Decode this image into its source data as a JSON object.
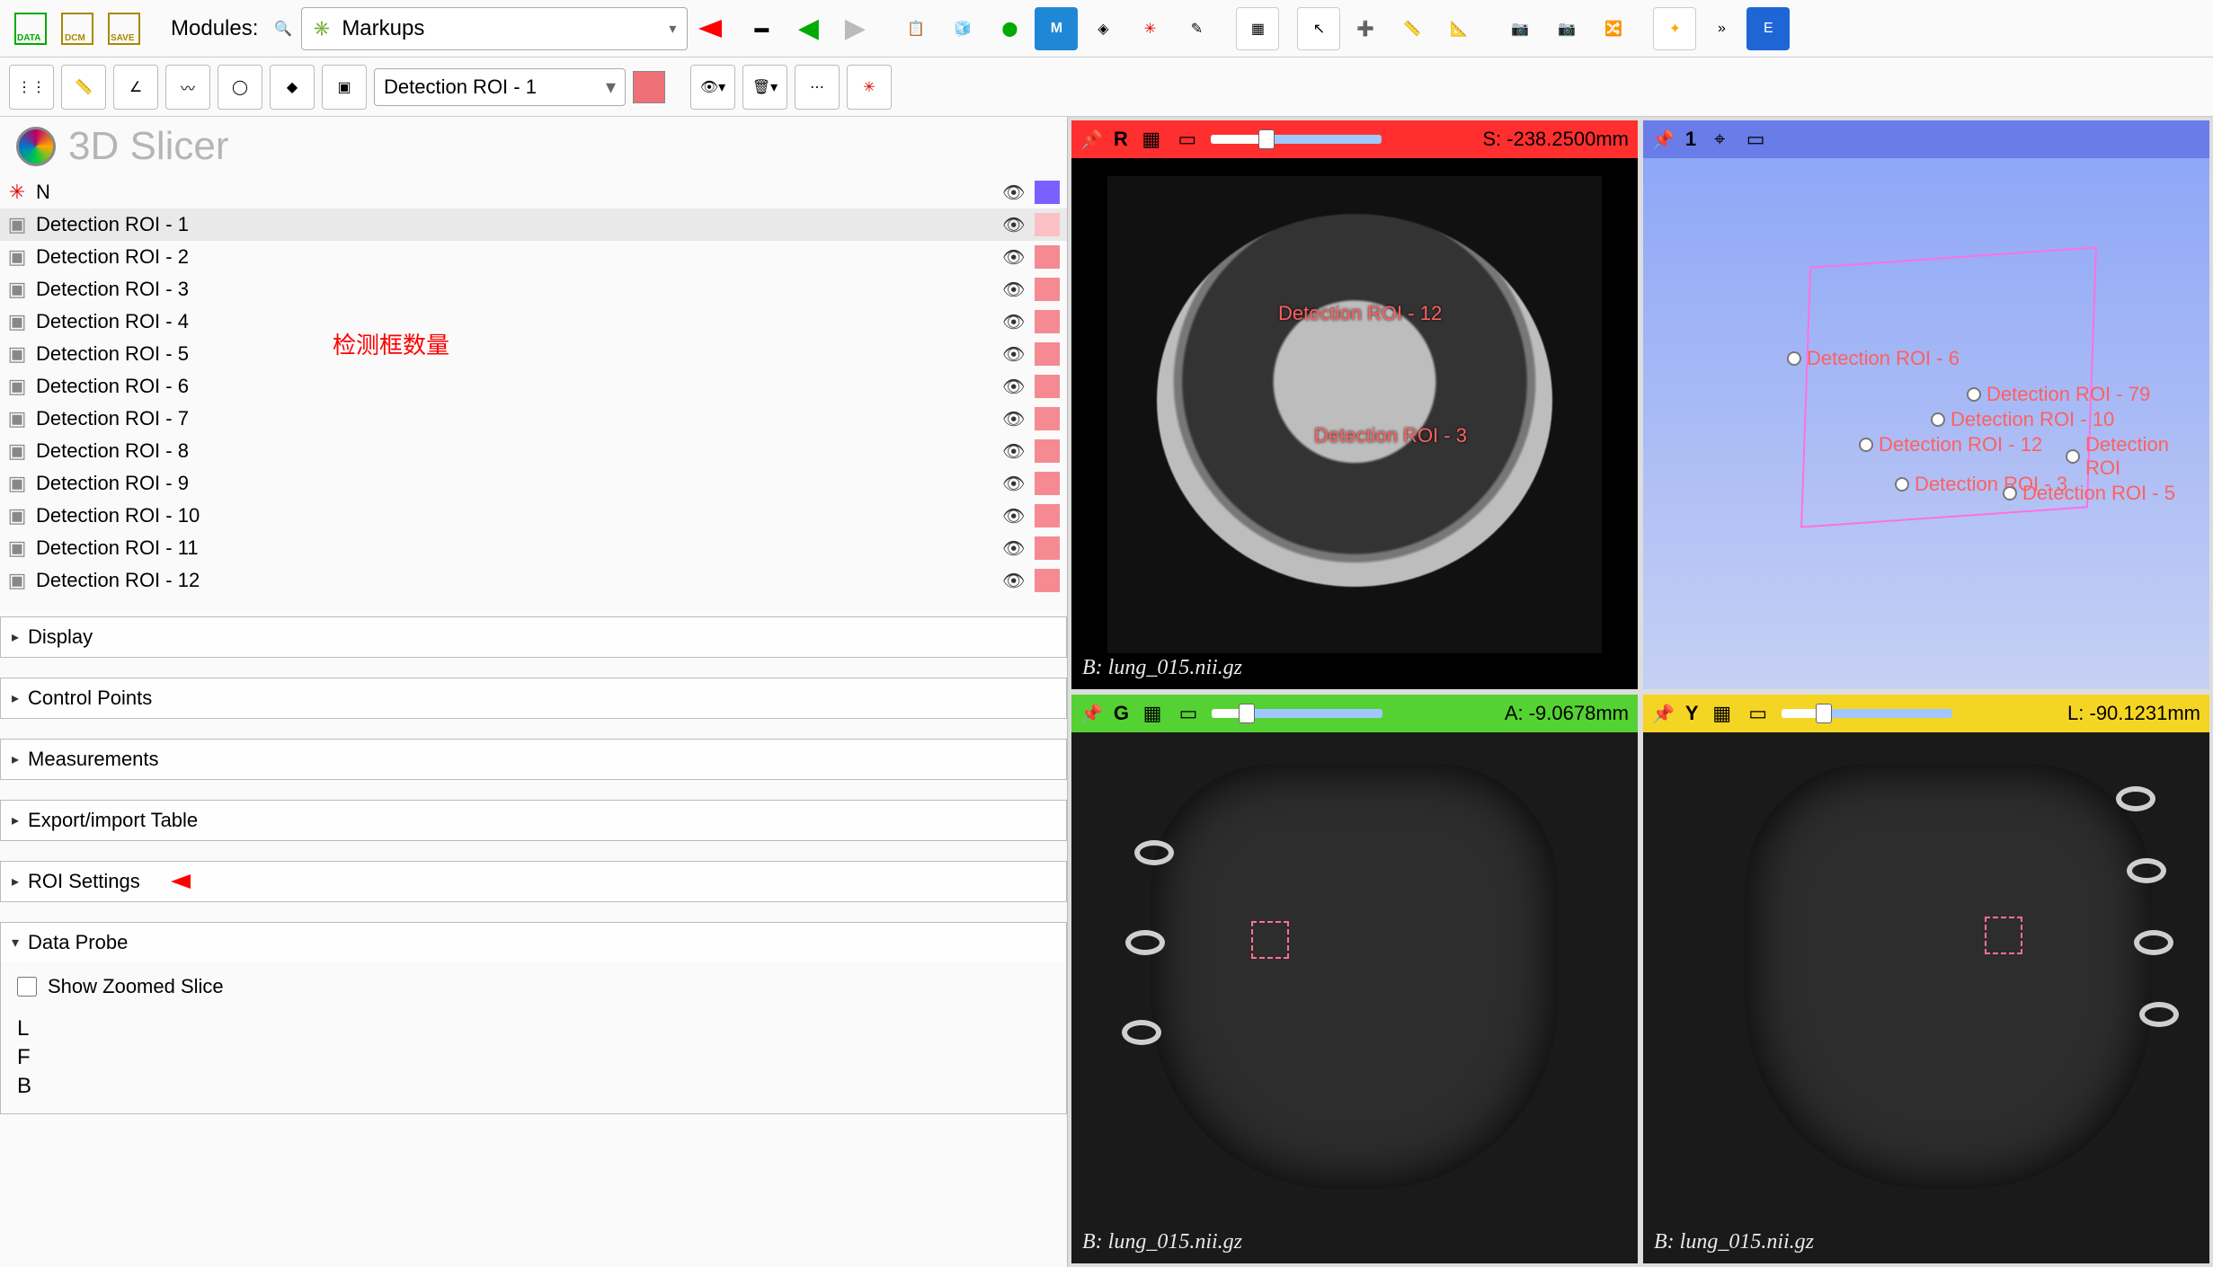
{
  "toolbar": {
    "modules_label": "Modules:",
    "module_name": "Markups"
  },
  "markups_bar": {
    "roi_selected": "Detection ROI - 1"
  },
  "app": {
    "logo_text": "3D Slicer"
  },
  "tree": {
    "first": {
      "label": "N"
    },
    "items": [
      {
        "label": "Detection ROI - 1",
        "selected": true
      },
      {
        "label": "Detection ROI - 2",
        "selected": false
      },
      {
        "label": "Detection ROI - 3",
        "selected": false
      },
      {
        "label": "Detection ROI - 4",
        "selected": false
      },
      {
        "label": "Detection ROI - 5",
        "selected": false
      },
      {
        "label": "Detection ROI - 6",
        "selected": false
      },
      {
        "label": "Detection ROI - 7",
        "selected": false
      },
      {
        "label": "Detection ROI - 8",
        "selected": false
      },
      {
        "label": "Detection ROI - 9",
        "selected": false
      },
      {
        "label": "Detection ROI - 10",
        "selected": false
      },
      {
        "label": "Detection ROI - 11",
        "selected": false
      },
      {
        "label": "Detection ROI - 12",
        "selected": false
      }
    ],
    "annotation": "检测框数量"
  },
  "panels": {
    "display": "Display",
    "control_points": "Control Points",
    "measurements": "Measurements",
    "export": "Export/import Table",
    "roi_settings": "ROI Settings",
    "data_probe": "Data Probe"
  },
  "data_probe": {
    "show_zoomed": "Show Zoomed Slice",
    "L": "L",
    "F": "F",
    "B": "B"
  },
  "views": {
    "red": {
      "letter": "R",
      "value": "S: -238.2500mm",
      "file": "B: lung_015.nii.gz",
      "label12": "Detection ROI - 12",
      "label3": "Detection ROI - 3"
    },
    "blue": {
      "letter": "1",
      "nodes": {
        "n6": "Detection ROI - 6",
        "n79": "Detection ROI - 79",
        "n10": "Detection ROI - 10",
        "n12b": "Detection ROI - 12",
        "nROI": "Detection ROI",
        "n3": "Detection ROI - 3",
        "n5": "Detection ROI - 5"
      }
    },
    "green": {
      "letter": "G",
      "value": "A: -9.0678mm",
      "file": "B: lung_015.nii.gz"
    },
    "yellow": {
      "letter": "Y",
      "value": "L: -90.1231mm",
      "file": "B: lung_015.nii.gz"
    }
  }
}
